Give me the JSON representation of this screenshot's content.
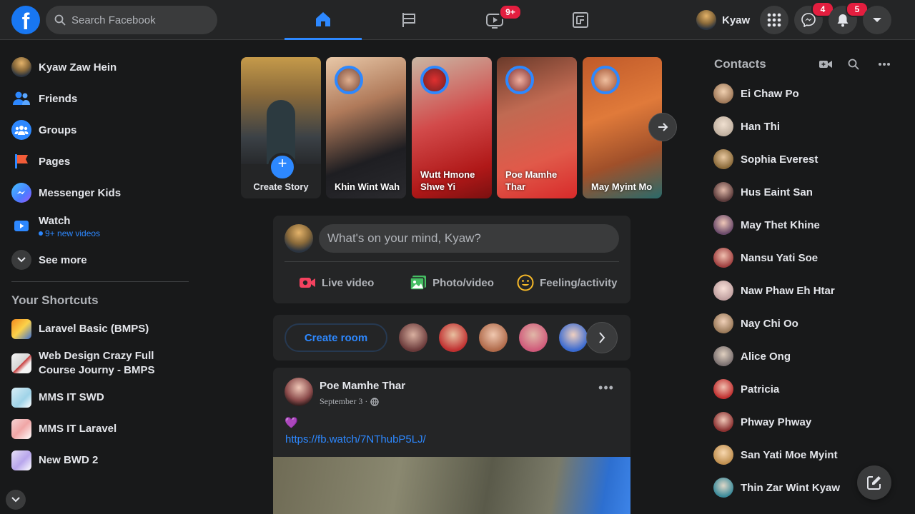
{
  "search": {
    "placeholder": "Search Facebook"
  },
  "header": {
    "profile_name": "Kyaw",
    "watch_badge": "9+",
    "messenger_badge": "4",
    "notifications_badge": "5",
    "accent": "#2d88ff",
    "badge_color": "#e41e3f"
  },
  "sidebar": {
    "items": [
      {
        "label": "Kyaw Zaw Hein",
        "icon": "profile-avatar"
      },
      {
        "label": "Friends",
        "icon": "friends-icon"
      },
      {
        "label": "Groups",
        "icon": "groups-icon"
      },
      {
        "label": "Pages",
        "icon": "pages-flag-icon"
      },
      {
        "label": "Messenger Kids",
        "icon": "messenger-kids-icon"
      },
      {
        "label": "Watch",
        "sub": "9+ new videos",
        "icon": "watch-icon"
      },
      {
        "label": "See more",
        "icon": "chevron-down-icon"
      }
    ],
    "shortcuts_title": "Your Shortcuts",
    "shortcuts": [
      {
        "label": "Laravel Basic (BMPS)"
      },
      {
        "label": "Web Design Crazy Full Course Journy - BMPS"
      },
      {
        "label": "MMS IT SWD"
      },
      {
        "label": "MMS IT Laravel"
      },
      {
        "label": "New BWD 2"
      }
    ]
  },
  "stories": {
    "create_label": "Create Story",
    "items": [
      {
        "name": "Khin Wint Wah"
      },
      {
        "name": "Wutt Hmone Shwe Yi"
      },
      {
        "name": "Poe Mamhe Thar"
      },
      {
        "name": "May Myint Mo"
      }
    ]
  },
  "composer": {
    "placeholder": "What's on your mind, Kyaw?",
    "actions": [
      {
        "label": "Live video",
        "icon": "live-video-icon"
      },
      {
        "label": "Photo/video",
        "icon": "photo-icon"
      },
      {
        "label": "Feeling/activity",
        "icon": "feeling-icon"
      }
    ]
  },
  "rooms": {
    "create_label": "Create room"
  },
  "post": {
    "author": "Poe Mamhe Thar",
    "date": "September 3 ·",
    "emoji": "💜",
    "link": "https://fb.watch/7NThubP5LJ/"
  },
  "contacts": {
    "title": "Contacts",
    "list": [
      "Ei Chaw Po",
      "Han Thi",
      "Sophia Everest",
      "Hus Eaint San",
      "May Thet Khine",
      "Nansu Yati Soe",
      "Naw Phaw Eh Htar",
      "Nay Chi Oo",
      "Alice Ong",
      "Patricia",
      "Phway Phway",
      "San Yati Moe Myint",
      "Thin Zar Wint Kyaw"
    ]
  }
}
